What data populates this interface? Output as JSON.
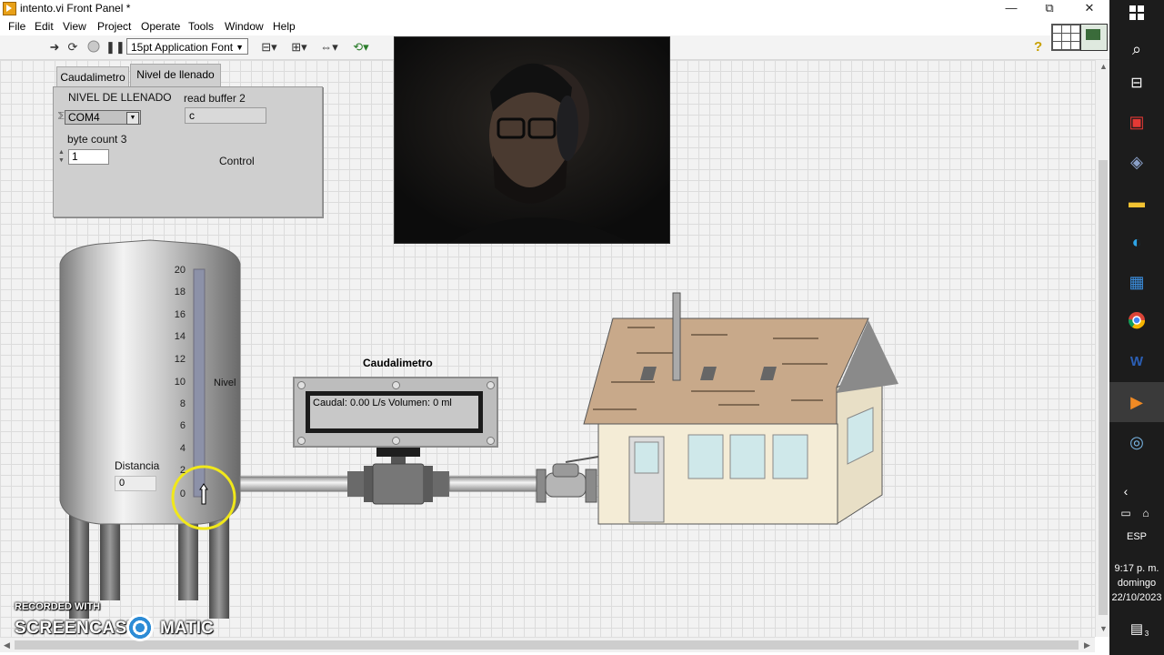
{
  "window": {
    "title": "intento.vi Front Panel *",
    "minimize": "—",
    "restore": "⧉",
    "close": "✕"
  },
  "menu": [
    "File",
    "Edit",
    "View",
    "Project",
    "Operate",
    "Tools",
    "Window",
    "Help"
  ],
  "toolbar": {
    "font_select": "15pt Application Font",
    "help_icon": "?"
  },
  "tabs": {
    "items": [
      "Caudalimetro",
      "Nivel de llenado"
    ],
    "active": "Nivel de llenado"
  },
  "panel": {
    "nivel_label": "NIVEL DE LLENADO",
    "com_value": "COM4",
    "read_buffer_label": "read buffer 2",
    "read_buffer_value": "c",
    "byte_count_label": "byte count 3",
    "byte_count_value": "1",
    "control_label": "Control"
  },
  "tank": {
    "scale_ticks": [
      "20",
      "18",
      "16",
      "14",
      "12",
      "10",
      "8",
      "6",
      "4",
      "2",
      "0"
    ],
    "level_value": 0,
    "level_max": 20,
    "nivel_label": "Nivel",
    "distancia_label": "Distancia",
    "distancia_value": "0"
  },
  "meter": {
    "title": "Caudalimetro",
    "display": "Caudal: 0.00 L/s  Volumen: 0 ml"
  },
  "watermark": {
    "line1": "RECORDED WITH",
    "brand_left": "SCREENCAST",
    "brand_right": "MATIC"
  },
  "taskbar": {
    "language": "ESP",
    "time": "9:17 p. m.",
    "day": "domingo",
    "date": "22/10/2023",
    "notification_count": "3"
  },
  "colors": {
    "canvas": "#f2f2f2",
    "grid": "#dcdcdc",
    "taskbar": "#1c1c1c",
    "highlight_ring": "#f1e81a",
    "roof": "#c8a98a",
    "wall": "#f4ecd6"
  }
}
